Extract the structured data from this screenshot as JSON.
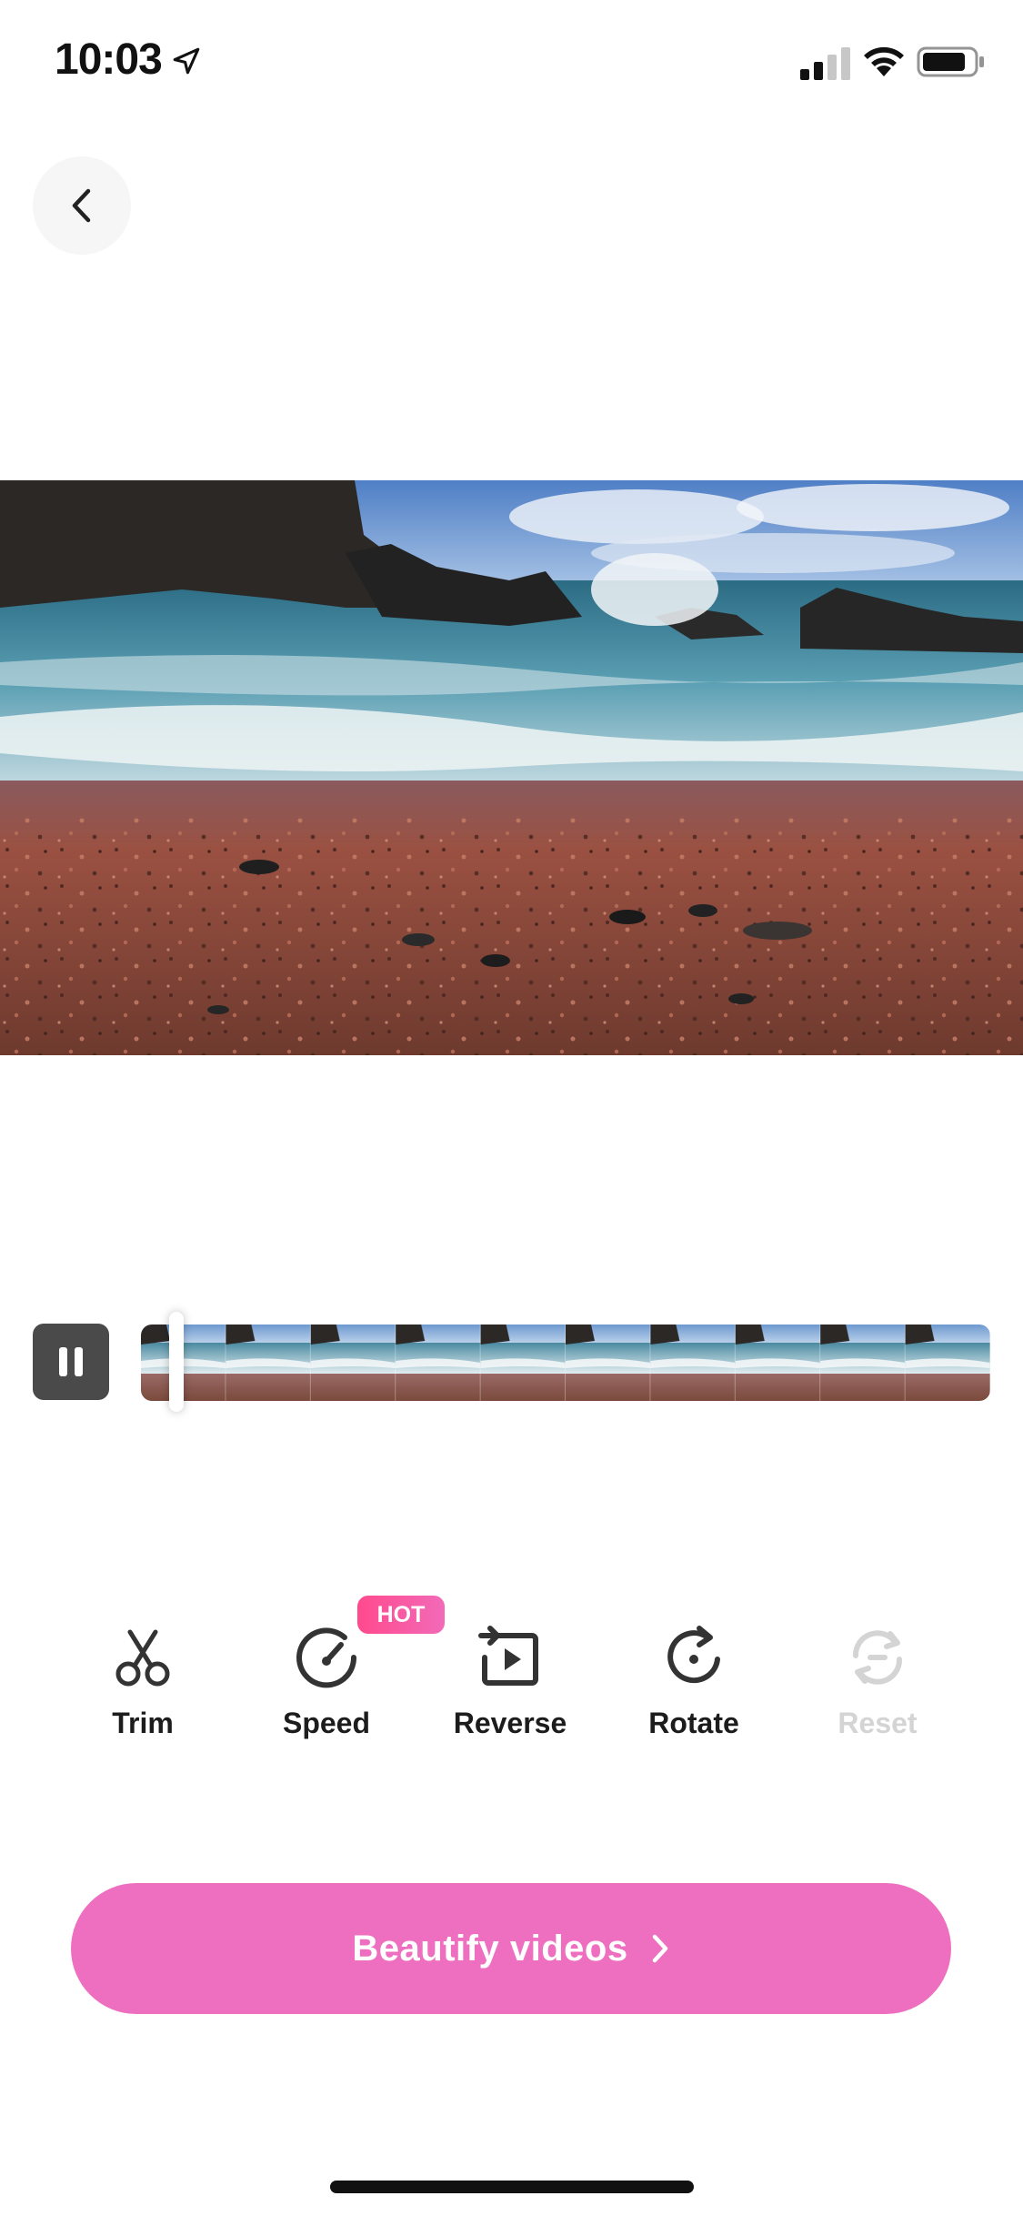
{
  "status_bar": {
    "time": "10:03"
  },
  "header": {
    "back_icon": "chevron-left-icon"
  },
  "player": {
    "state": "playing",
    "pause_icon": "pause-icon",
    "playhead_progress": 0.03
  },
  "tools": [
    {
      "label": "Trim",
      "icon": "scissors-icon",
      "enabled": true
    },
    {
      "label": "Speed",
      "icon": "speedometer-icon",
      "enabled": true,
      "badge": "HOT"
    },
    {
      "label": "Reverse",
      "icon": "reverse-icon",
      "enabled": true
    },
    {
      "label": "Rotate",
      "icon": "rotate-icon",
      "enabled": true
    },
    {
      "label": "Reset",
      "icon": "reset-icon",
      "enabled": false
    }
  ],
  "cta": {
    "label": "Beautify videos"
  },
  "colors": {
    "accent": "#EE6FBF",
    "badge": "#FF4A8D",
    "disabled": "#D4D4D4"
  }
}
